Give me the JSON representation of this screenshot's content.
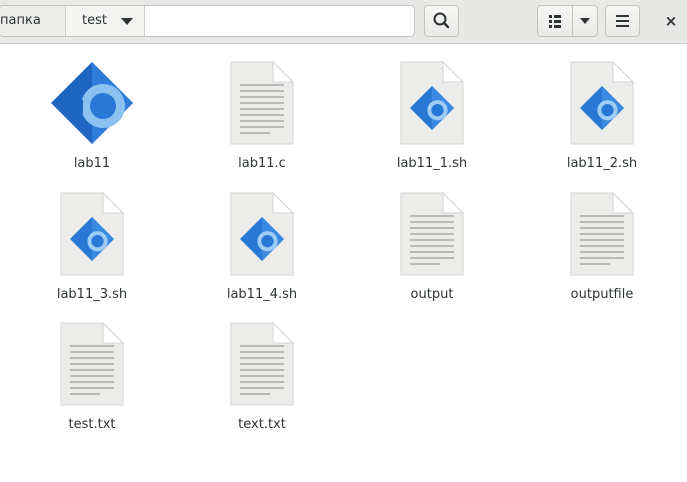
{
  "window": {
    "pathbar": {
      "parent_crumb": "Домашняя папка",
      "current_crumb": "test"
    },
    "buttons": [
      "search",
      "view-list",
      "view-options",
      "menu",
      "close"
    ],
    "close_glyph": "×"
  },
  "files": [
    {
      "name": "lab11",
      "icon": "executable-icon"
    },
    {
      "name": "lab11.c",
      "icon": "text-document-icon"
    },
    {
      "name": "lab11_1.sh",
      "icon": "script-icon"
    },
    {
      "name": "lab11_2.sh",
      "icon": "script-icon"
    },
    {
      "name": "lab11_3.sh",
      "icon": "script-icon"
    },
    {
      "name": "lab11_4.sh",
      "icon": "script-icon"
    },
    {
      "name": "output",
      "icon": "text-document-icon"
    },
    {
      "name": "outputfile",
      "icon": "text-document-icon"
    },
    {
      "name": "test.txt",
      "icon": "text-document-icon"
    },
    {
      "name": "text.txt",
      "icon": "text-document-icon"
    }
  ],
  "colors": {
    "header_bg": "#e8e8e7",
    "exec_blue": "#2a78d6",
    "exec_light": "#6fb1f0",
    "paper": "#ececeb"
  }
}
